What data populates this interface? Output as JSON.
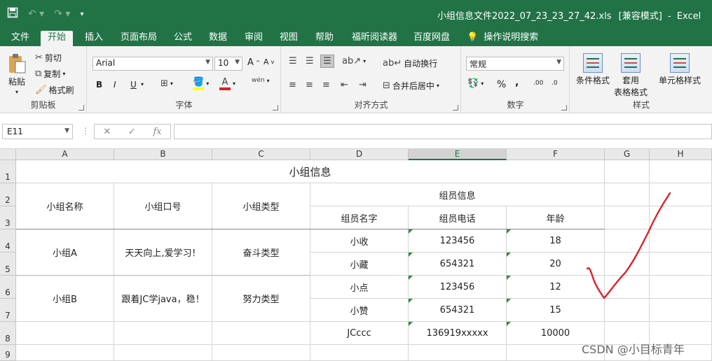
{
  "title_bar": {
    "save_icon": "save-icon",
    "undo_icon": "undo-icon",
    "redo_icon": "redo-icon",
    "customize_icon": "customize-qat-icon",
    "file_title": "小组信息文件2022_07_23_23_27_42.xls",
    "mode": "[兼容模式]",
    "app": "Excel"
  },
  "tabs": [
    "文件",
    "开始",
    "插入",
    "页面布局",
    "公式",
    "数据",
    "审阅",
    "视图",
    "帮助",
    "福昕阅读器",
    "百度网盘",
    "操作说明搜索"
  ],
  "ribbon": {
    "clipboard": {
      "label": "剪贴板",
      "paste": "粘贴",
      "cut": "剪切",
      "copy": "复制",
      "format_painter": "格式刷"
    },
    "font": {
      "label": "字体",
      "name": "Arial",
      "size": "10",
      "bold": "B",
      "italic": "I",
      "underline": "U",
      "phonetic": "wén"
    },
    "alignment": {
      "label": "对齐方式",
      "wrap": "自动换行",
      "merge": "合并后居中"
    },
    "number": {
      "label": "数字",
      "format": "常规",
      "percent": "%",
      "comma": ",",
      "inc_decimal": ".00",
      "dec_decimal": ".0"
    },
    "styles": {
      "label": "样式",
      "conditional": "条件格式",
      "table_1": "套用",
      "table_2": "表格格式",
      "cell_styles": "单元格样式"
    }
  },
  "formula_bar": {
    "name_box": "E11",
    "cancel": "✕",
    "enter": "✓",
    "fx": "fx",
    "value": ""
  },
  "columns": [
    "A",
    "B",
    "C",
    "D",
    "E",
    "F",
    "G",
    "H"
  ],
  "selected_column": "E",
  "rows": [
    "1",
    "2",
    "3",
    "4",
    "5",
    "6",
    "7",
    "8",
    "9"
  ],
  "sheet": {
    "title": "小组信息",
    "h_group_name": "小组名称",
    "h_slogan": "小组口号",
    "h_type": "小组类型",
    "h_member_info": "组员信息",
    "h_member_name": "组员名字",
    "h_member_phone": "组员电话",
    "h_age": "年龄",
    "groups": [
      {
        "name": "小组A",
        "slogan": "天天向上,爱学习！",
        "type": "奋斗类型"
      },
      {
        "name": "小组B",
        "slogan": "跟着JC学java，稳！",
        "type": "努力类型"
      }
    ],
    "members": [
      {
        "name": "小收",
        "phone": "123456",
        "age": "18"
      },
      {
        "name": "小藏",
        "phone": "654321",
        "age": "20"
      },
      {
        "name": "小点",
        "phone": "123456",
        "age": "12"
      },
      {
        "name": "小赞",
        "phone": "654321",
        "age": "15"
      },
      {
        "name": "JCccc",
        "phone": "136919xxxxx",
        "age": "10000"
      }
    ]
  },
  "annotation": {
    "checkmark_color": "#e0202a",
    "accent": "#217346"
  },
  "watermark": "CSDN @小目标青年"
}
